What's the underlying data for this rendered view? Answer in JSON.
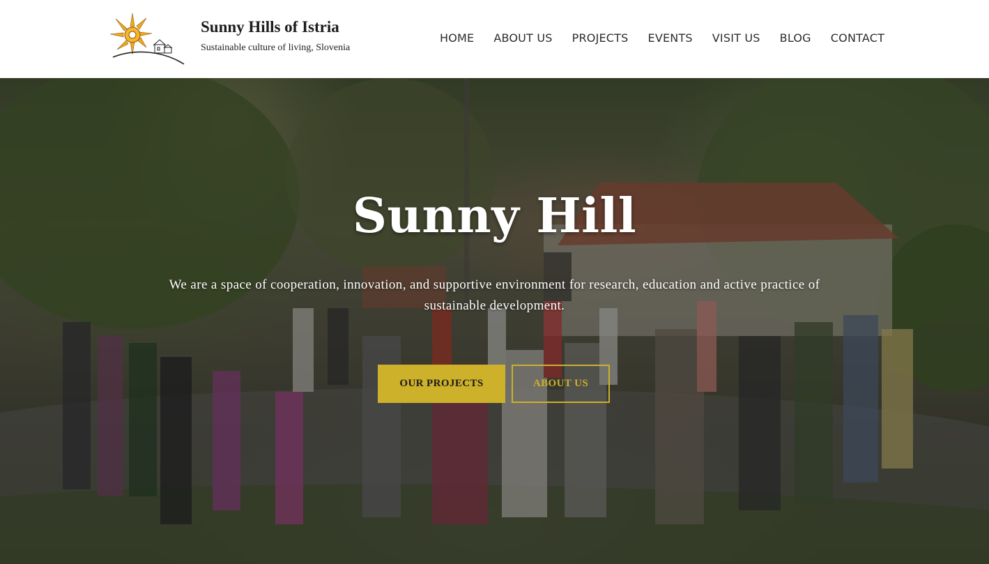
{
  "site": {
    "title": "Sunny Hills of Istria",
    "tagline": "Sustainable culture of living, Slovenia",
    "logo_icon": "sun-over-hill-house-logo"
  },
  "nav": {
    "items": [
      {
        "label": "HOME"
      },
      {
        "label": "ABOUT US"
      },
      {
        "label": "PROJECTS"
      },
      {
        "label": "EVENTS"
      },
      {
        "label": "VISIT US"
      },
      {
        "label": "BLOG"
      },
      {
        "label": "CONTACT"
      }
    ]
  },
  "hero": {
    "title": "Sunny Hill",
    "subtitle": "We are a space of cooperation, innovation, and supportive environment for research, education and active practice of sustainable development.",
    "primary_button": "OUR PROJECTS",
    "secondary_button": "ABOUT US"
  },
  "colors": {
    "accent": "#cdb12a",
    "logo_sun": "#f2a81d",
    "nav_text": "#2c2c2c",
    "header_bg": "#ffffff"
  }
}
